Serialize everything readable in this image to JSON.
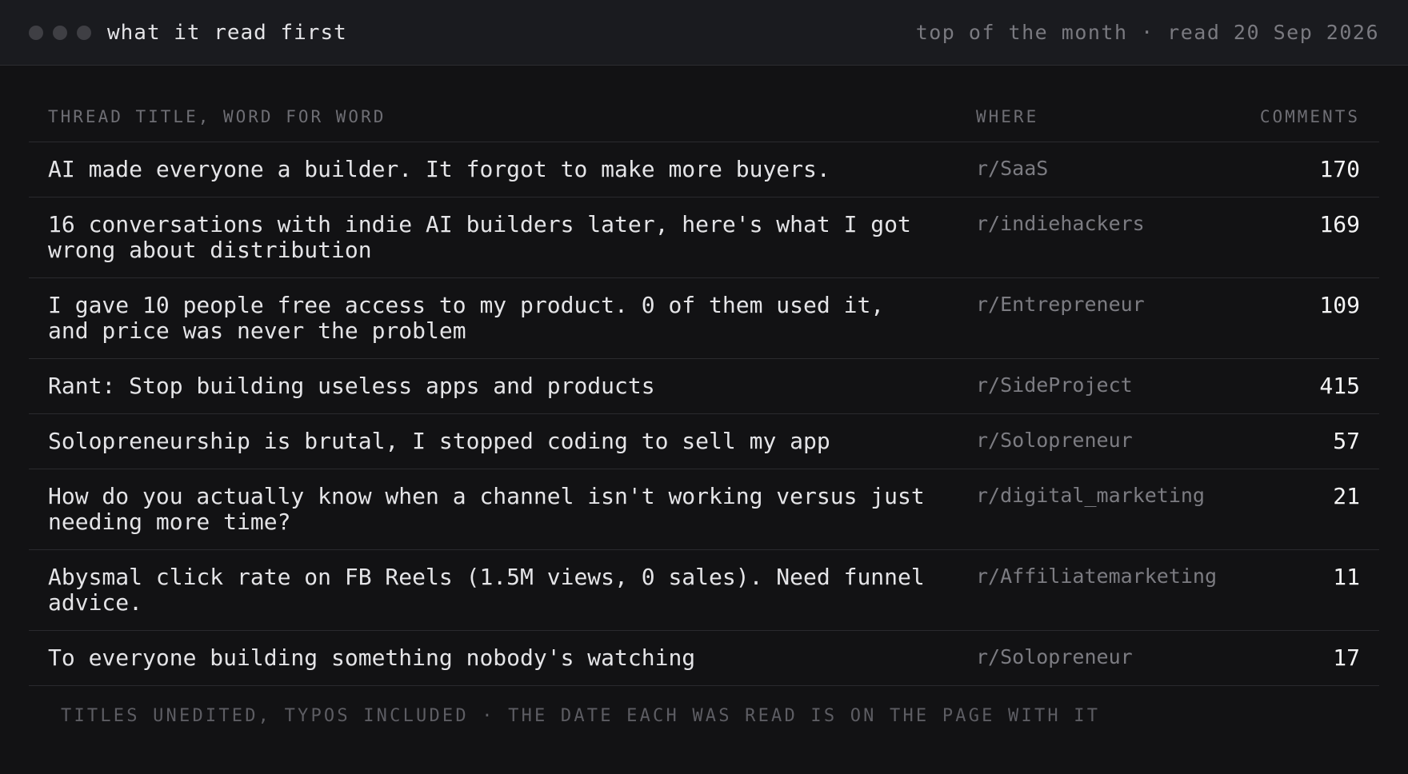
{
  "window": {
    "title": "what it read first",
    "meta": "top of the month · read 20 Sep 2026"
  },
  "table": {
    "headers": {
      "title": "THREAD TITLE, WORD FOR WORD",
      "where": "WHERE",
      "comments": "COMMENTS"
    },
    "rows": [
      {
        "title": "AI made everyone a builder. It forgot to make more buyers.",
        "where": "r/SaaS",
        "comments": "170"
      },
      {
        "title": "16 conversations with indie AI builders later, here's what I got wrong about distribution",
        "where": "r/indiehackers",
        "comments": "169"
      },
      {
        "title": "I gave 10 people free access to my product. 0 of them used it, and price was never the problem",
        "where": "r/Entrepreneur",
        "comments": "109"
      },
      {
        "title": "Rant: Stop building useless apps and products",
        "where": "r/SideProject",
        "comments": "415"
      },
      {
        "title": "Solopreneurship is brutal, I stopped coding to sell my app",
        "where": "r/Solopreneur",
        "comments": "57"
      },
      {
        "title": "How do you actually know when a channel isn't working versus just needing more time?",
        "where": "r/digital_marketing",
        "comments": "21"
      },
      {
        "title": "Abysmal click rate on FB Reels (1.5M views, 0 sales). Need funnel advice.",
        "where": "r/Affiliatemarketing",
        "comments": "11"
      },
      {
        "title": "To everyone building something nobody's watching",
        "where": "r/Solopreneur",
        "comments": "17"
      }
    ]
  },
  "footer": {
    "note": "TITLES UNEDITED, TYPOS INCLUDED · THE DATE EACH WAS READ IS ON THE PAGE WITH IT"
  }
}
